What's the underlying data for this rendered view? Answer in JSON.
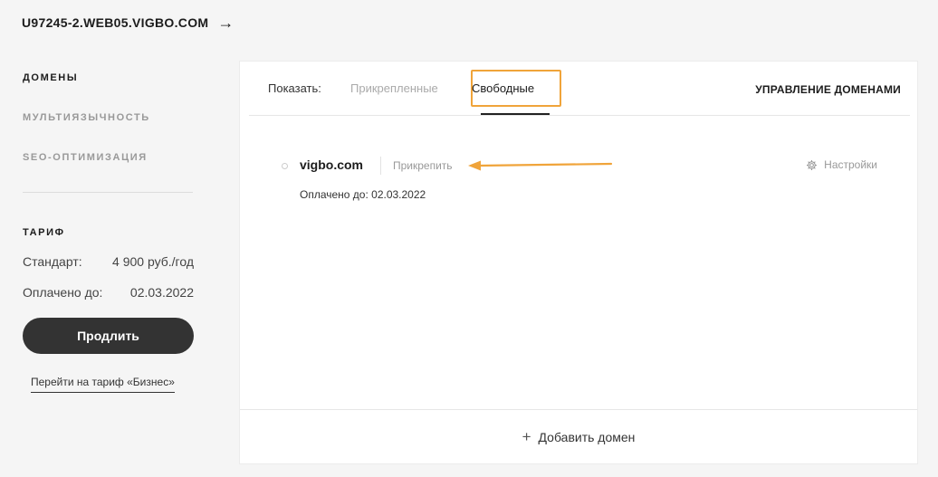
{
  "site": {
    "title": "U97245-2.WEB05.VIGBO.COM",
    "arrow_icon": "arrow-right-icon"
  },
  "sidebar": {
    "items": [
      {
        "label": "ДОМЕНЫ",
        "active": true
      },
      {
        "label": "МУЛЬТИЯЗЫЧНОСТЬ",
        "active": false
      },
      {
        "label": "SEO-ОПТИМИЗАЦИЯ",
        "active": false
      }
    ],
    "tariff": {
      "title": "ТАРИФ",
      "plan_label": "Стандарт:",
      "plan_price": "4 900 руб./год",
      "paid_label": "Оплачено до:",
      "paid_date": "02.03.2022",
      "extend_button": "Продлить",
      "upgrade_link": "Перейти на тариф «Бизнес»"
    }
  },
  "panel": {
    "show_label": "Показать:",
    "tabs": [
      {
        "label": "Прикрепленные",
        "active": false
      },
      {
        "label": "Свободные",
        "active": true
      }
    ],
    "manage_link": "УПРАВЛЕНИЕ ДОМЕНАМИ",
    "domains": [
      {
        "name": "vigbo.com",
        "attach_label": "Прикрепить",
        "settings_label": "Настройки",
        "paid_text": "Оплачено до: 02.03.2022"
      }
    ],
    "add_domain": "Добавить домен"
  },
  "colors": {
    "highlight": "#f0a43a",
    "button_bg": "#333333",
    "text_dark": "#1c1c1c",
    "text_muted": "#999999"
  }
}
